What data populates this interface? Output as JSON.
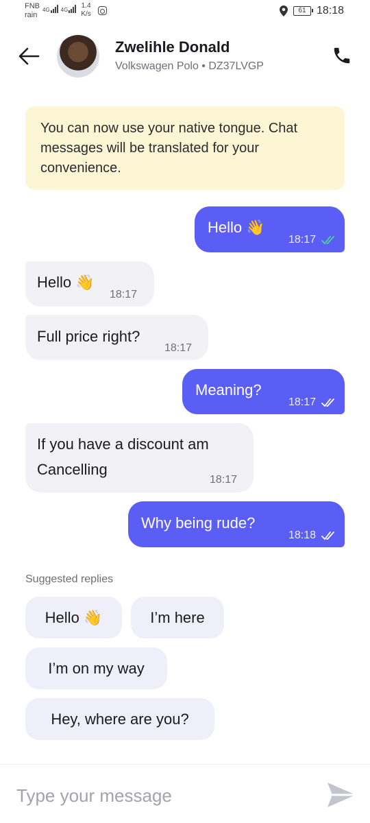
{
  "status_bar": {
    "carrier_top": "FNB",
    "carrier_bottom": "rain",
    "net1": "4G",
    "net2": "4G",
    "speed_value": "1.4",
    "speed_unit": "K/s",
    "battery": "61",
    "time": "18:18"
  },
  "header": {
    "name": "Zwelihle Donald",
    "vehicle": "Volkswagen Polo • DZ37LVGP"
  },
  "notice": "You can now use your native tongue. Chat messages will be translated for your convenience.",
  "messages": [
    {
      "dir": "out",
      "text": "Hello 👋",
      "time": "18:17",
      "status": "read"
    },
    {
      "dir": "in",
      "text": "Hello 👋",
      "time": "18:17"
    },
    {
      "dir": "in",
      "text": "Full price right?",
      "time": "18:17"
    },
    {
      "dir": "out",
      "text": "Meaning?",
      "time": "18:17",
      "status": "delivered"
    },
    {
      "dir": "in",
      "text_line1": "If you have a discount am",
      "text_line2": "Cancelling",
      "time": "18:17"
    },
    {
      "dir": "out",
      "text": "Why being rude?",
      "time": "18:18",
      "status": "delivered"
    }
  ],
  "suggested": {
    "label": "Suggested replies",
    "replies": [
      "Hello 👋",
      "I’m here",
      "I’m on my way",
      "Hey, where are you?"
    ]
  },
  "input": {
    "placeholder": "Type your message"
  },
  "colors": {
    "outgoing_bubble": "#5b5ef4",
    "incoming_bubble": "#f2f2f6",
    "notice_bg": "#fdf6d4",
    "read_tick": "#4fd1a0",
    "chip_bg": "#efeff9"
  }
}
